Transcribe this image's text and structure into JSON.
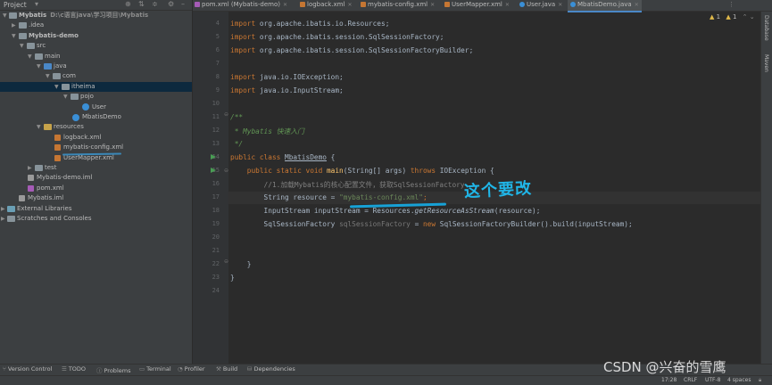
{
  "project_header": {
    "title": "Project",
    "icons": [
      "gear-icon",
      "collapse-icon",
      "hide-icon"
    ]
  },
  "tree": [
    {
      "label": "Mybatis",
      "path": "D:\\c语言java\\学习项目\\Mybatis",
      "bold": true
    },
    {
      "label": ".idea"
    },
    {
      "label": "Mybatis-demo",
      "bold": true
    },
    {
      "label": "src"
    },
    {
      "label": "main"
    },
    {
      "label": "java"
    },
    {
      "label": "com"
    },
    {
      "label": "itheima"
    },
    {
      "label": "pojo"
    },
    {
      "label": "User"
    },
    {
      "label": "MbatisDemo"
    },
    {
      "label": "resources"
    },
    {
      "label": "logback.xml"
    },
    {
      "label": "mybatis-config.xml"
    },
    {
      "label": "UserMapper.xml"
    },
    {
      "label": "test"
    },
    {
      "label": "Mybatis-demo.iml"
    },
    {
      "label": "pom.xml"
    },
    {
      "label": "Mybatis.iml"
    },
    {
      "label": "External Libraries"
    },
    {
      "label": "Scratches and Consoles"
    }
  ],
  "tabs": [
    {
      "label": "pom.xml (Mybatis-demo)"
    },
    {
      "label": "logback.xml"
    },
    {
      "label": "mybatis-config.xml"
    },
    {
      "label": "UserMapper.xml"
    },
    {
      "label": "User.java"
    },
    {
      "label": "MbatisDemo.java",
      "active": true
    }
  ],
  "inspections": {
    "warnings": "1",
    "weak": "1"
  },
  "line_numbers": [
    "4",
    "5",
    "6",
    "7",
    "8",
    "9",
    "10",
    "11",
    "12",
    "13",
    "14",
    "15",
    "16",
    "17",
    "18",
    "19",
    "20",
    "21",
    "22",
    "23",
    "24"
  ],
  "code": {
    "l4_kw": "import",
    "l4_rest": " org.apache.ibatis.io.Resources;",
    "l5_kw": "import",
    "l5_rest": " org.apache.ibatis.session.SqlSessionFactory;",
    "l6_kw": "import",
    "l6_rest": " org.apache.ibatis.session.SqlSessionFactoryBuilder;",
    "l8_kw": "import",
    "l8_rest": " java.io.IOException;",
    "l9_kw": "import",
    "l9_rest": " java.io.InputStream;",
    "l11": "/**",
    "l12": " * Mybatis 快速入门",
    "l13": " */",
    "l14_kw": "public class ",
    "l14_name": "MbatisDemo",
    "l14_rest": " {",
    "l15_kw1": "    public static void ",
    "l15_fn": "main",
    "l15_mid": "(String[] args) ",
    "l15_kw2": "throws",
    "l15_rest": " IOException {",
    "l16": "        //1.加载Mybatis的核心配置文件，获取SqlSessionFactory",
    "l17_pre": "        String resource = ",
    "l17_str": "\"mybatis-config.xml\"",
    "l17_rest": ";",
    "l18_pre": "        InputStream inputStream = Resources.",
    "l18_fn": "getResourceAsStream",
    "l18_rest": "(resource);",
    "l19_pre": "        SqlSessionFactory ",
    "l19_var": "sqlSessionFactory",
    "l19_mid": " = ",
    "l19_kw": "new",
    "l19_rest": " SqlSessionFactoryBuilder().build(inputStream);",
    "l22": "    }",
    "l23": "}"
  },
  "annotation": {
    "note": "这个要改"
  },
  "right_strip": {
    "database": "Database",
    "maven": "Maven"
  },
  "bottom_tools": [
    {
      "label": "Version Control"
    },
    {
      "label": "TODO"
    },
    {
      "label": "Problems"
    },
    {
      "label": "Terminal"
    },
    {
      "label": "Profiler"
    },
    {
      "label": "Build"
    },
    {
      "label": "Dependencies"
    }
  ],
  "status": {
    "position": "17:28",
    "line_sep": "CRLF",
    "encoding": "UTF-8",
    "indent": "4 spaces"
  },
  "watermark": "CSDN @兴奋的雪鹰"
}
